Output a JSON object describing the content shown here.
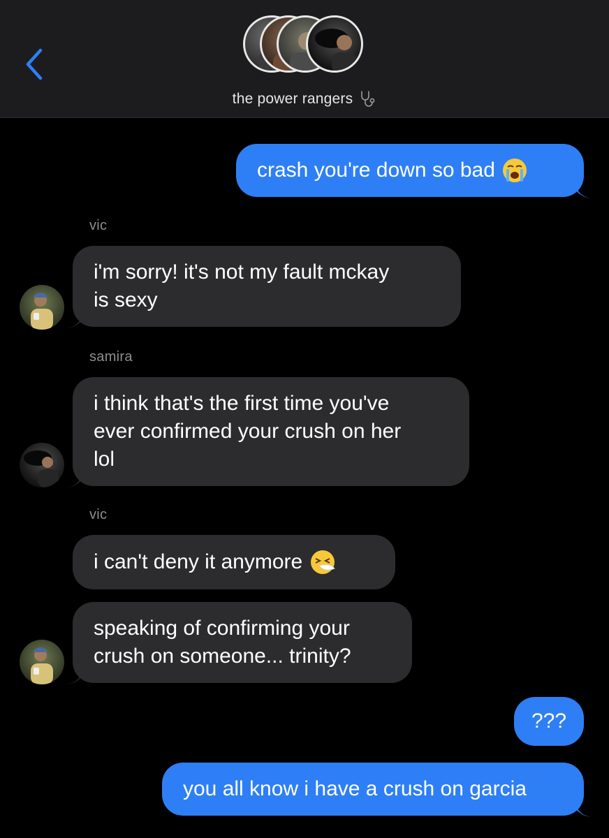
{
  "header": {
    "back_icon": "chevron-left-icon",
    "group_name": "the power rangers",
    "group_name_icon": "stethoscope-icon",
    "accent_color": "#2e7ff6"
  },
  "messages": [
    {
      "id": "m1",
      "direction": "sent",
      "text": "crash you're down so bad",
      "emoji": "loudly-crying-face"
    },
    {
      "id": "m2",
      "direction": "received",
      "sender": "vic",
      "text": "i'm sorry! it's not my fault mckay\nis sexy"
    },
    {
      "id": "m3",
      "direction": "received",
      "sender": "samira",
      "text": "i think that's the first time you've\never confirmed your crush on her\nlol"
    },
    {
      "id": "m4",
      "direction": "received",
      "sender": "vic",
      "text": "i can't deny it anymore",
      "emoji": "sneezing-face"
    },
    {
      "id": "m5",
      "direction": "received",
      "text": "speaking of confirming your\ncrush on someone... trinity?"
    },
    {
      "id": "m6",
      "direction": "sent",
      "text": "???"
    },
    {
      "id": "m7",
      "direction": "sent",
      "text": "you all know i have a crush on garcia"
    }
  ],
  "colors": {
    "sent_bubble": "#2e7ff6",
    "received_bubble": "#2c2c2e",
    "header_bg": "#1c1c1e",
    "sender_label": "#8e8e93"
  }
}
